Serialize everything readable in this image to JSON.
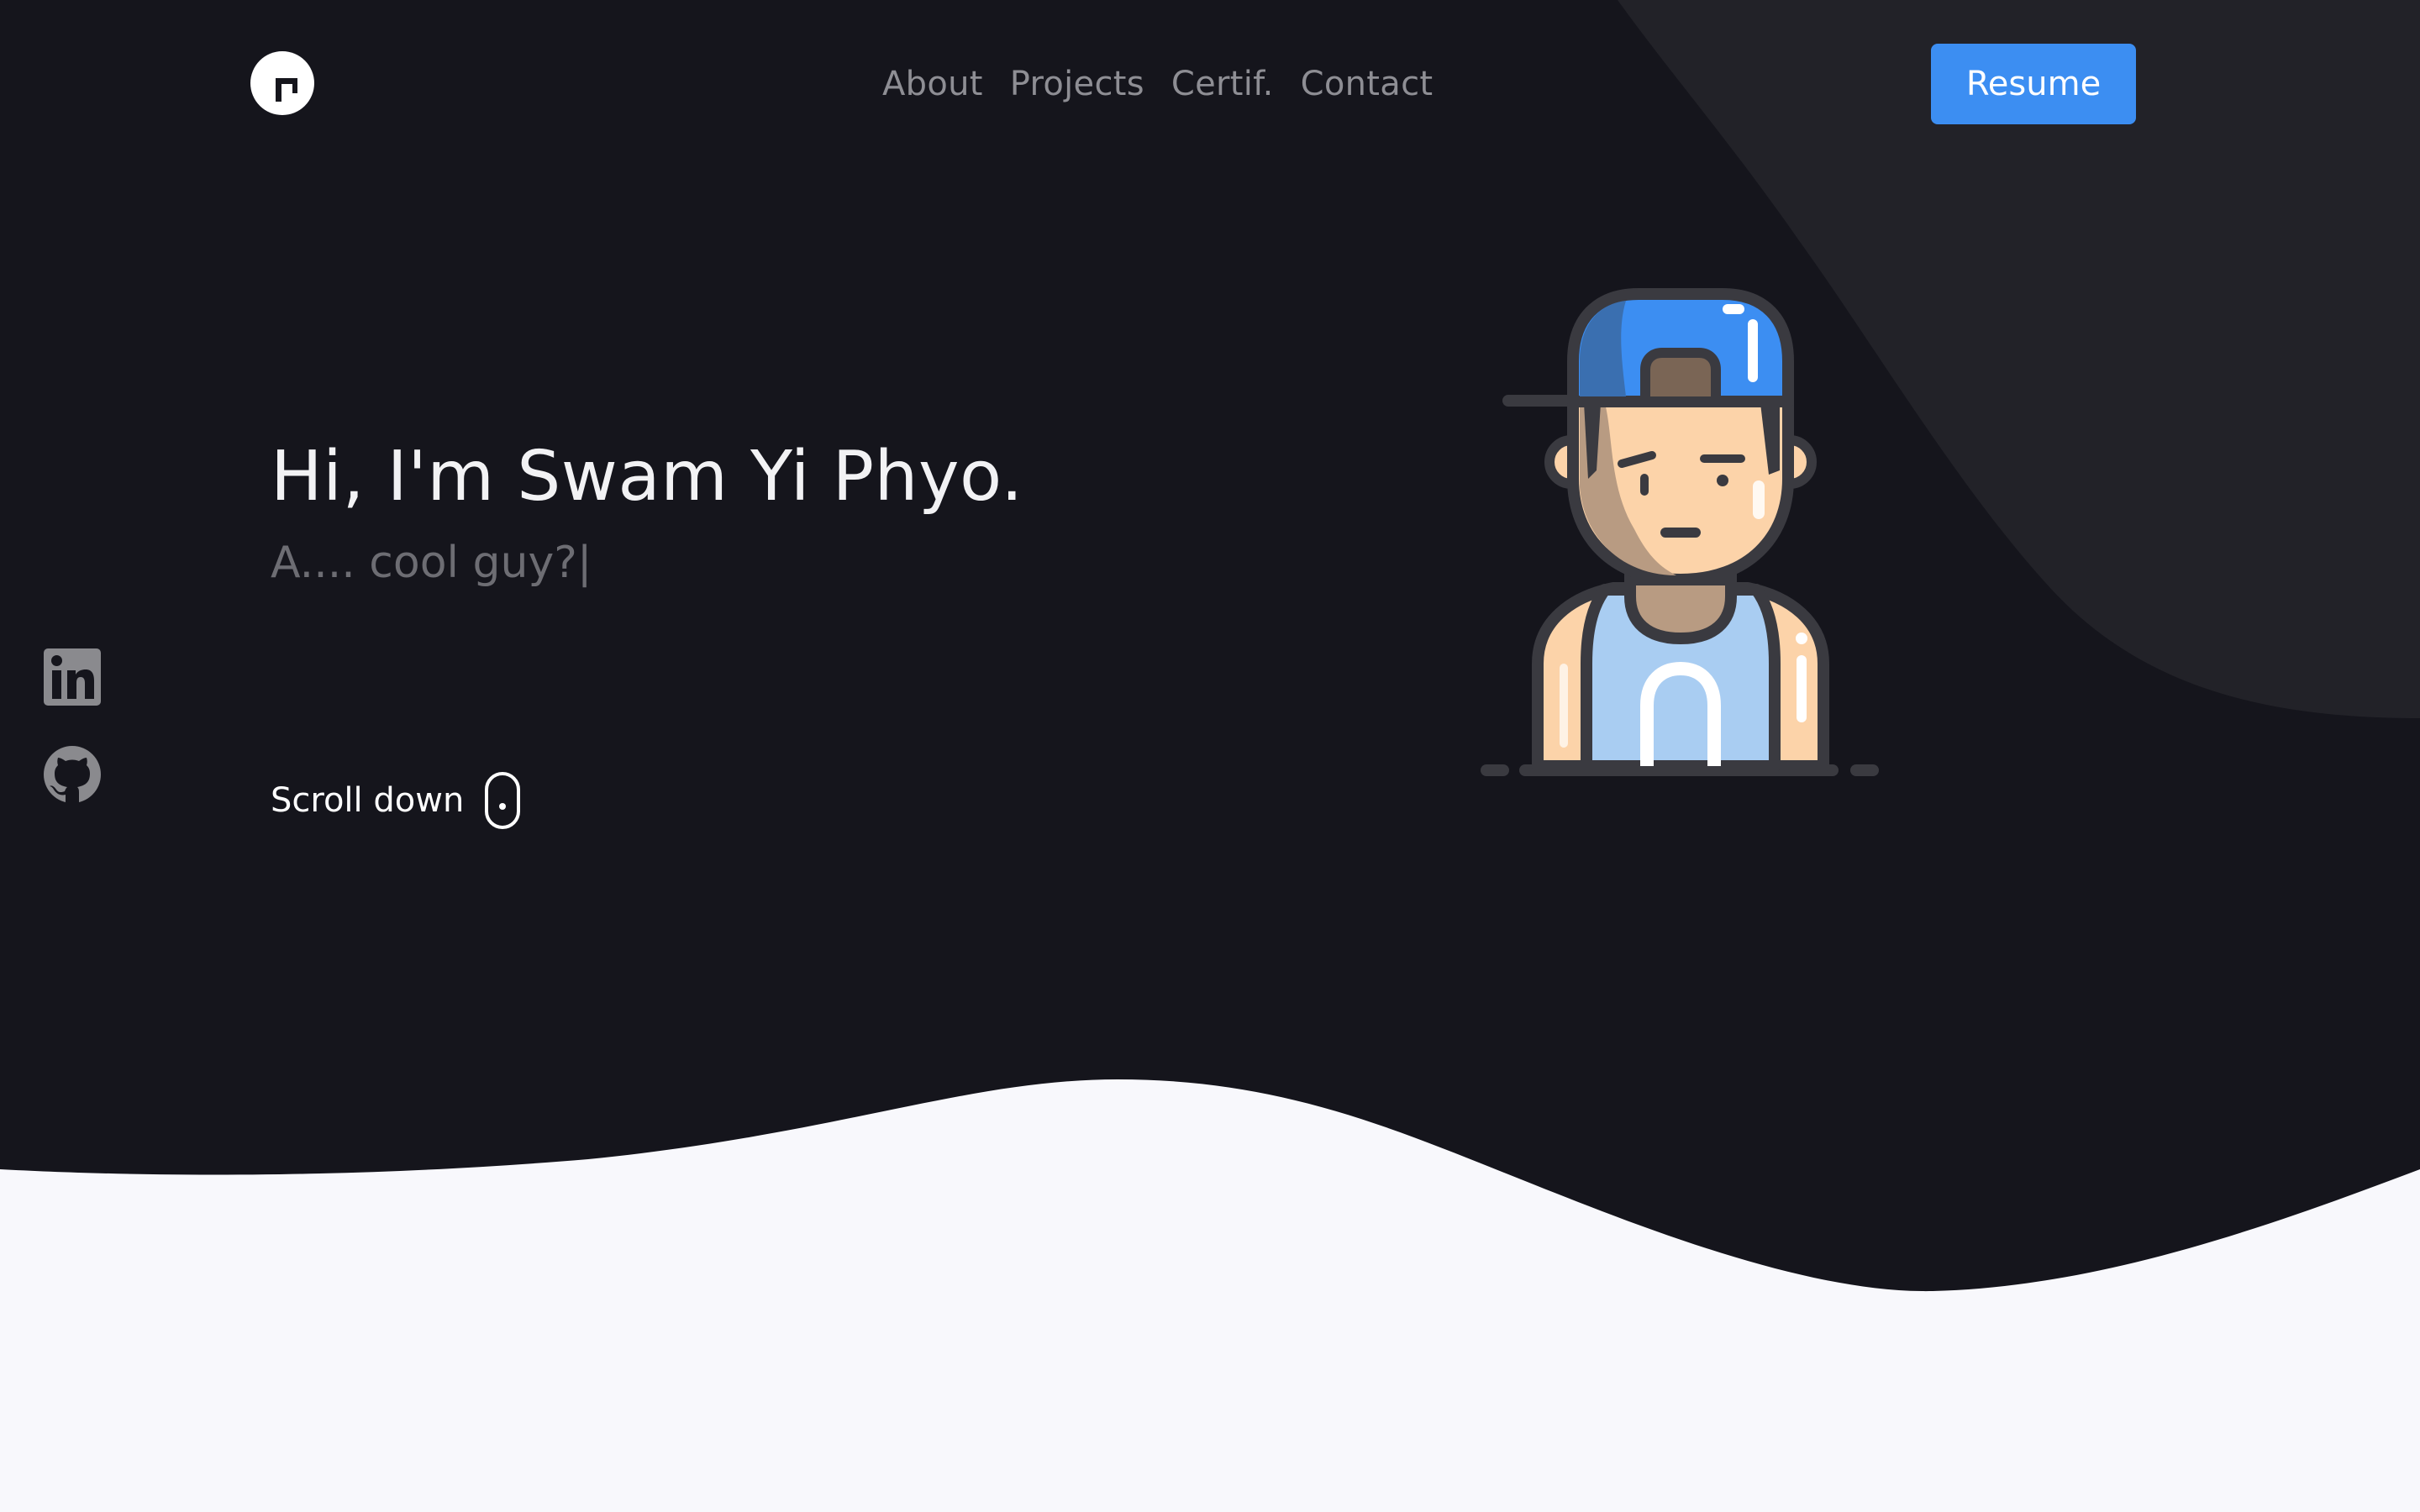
{
  "header": {
    "nav": [
      "About",
      "Projects",
      "Certif.",
      "Contact"
    ],
    "resume_label": "Resume"
  },
  "hero": {
    "title": "Hi, I'm Swam Yi Phyo.",
    "subtitle": "A.... cool guy?|",
    "scroll_label": "Scroll down"
  },
  "icons": {
    "logo": "logo-icon",
    "linkedin": "linkedin-icon",
    "github": "github-icon",
    "mouse": "mouse-scroll-icon",
    "avatar": "avatar-illustration"
  },
  "colors": {
    "background": "#15151c",
    "blob": "#222228",
    "wave": "#f8f8fc",
    "accent": "#3c8ef2",
    "nav_text": "#8e8e94",
    "subtitle": "#6d6d73"
  }
}
